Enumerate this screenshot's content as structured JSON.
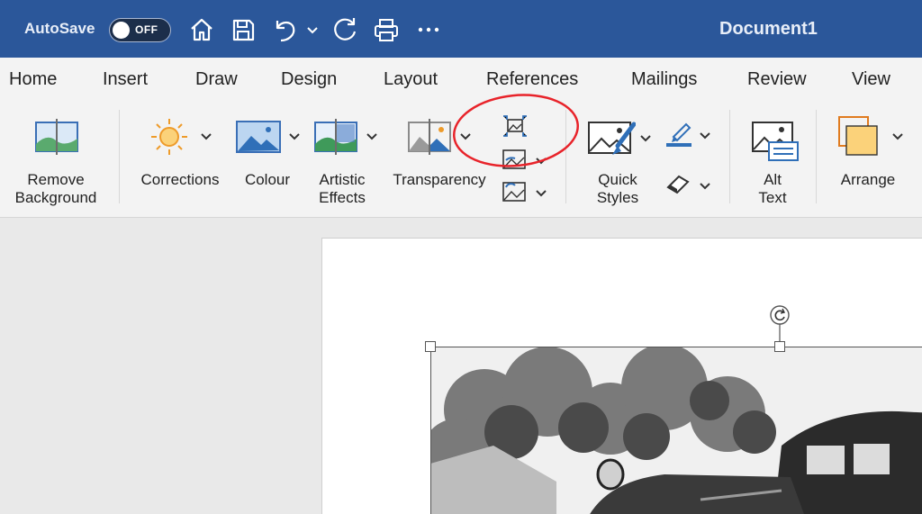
{
  "titlebar": {
    "autosave_label": "AutoSave",
    "toggle_text": "OFF",
    "document_title": "Document1",
    "background_color": "#2b579a"
  },
  "tabs": [
    "Home",
    "Insert",
    "Draw",
    "Design",
    "Layout",
    "References",
    "Mailings",
    "Review",
    "View"
  ],
  "ribbon": {
    "remove_background": [
      "Remove",
      "Background"
    ],
    "corrections": "Corrections",
    "colour": "Colour",
    "artistic_effects": [
      "Artistic",
      "Effects"
    ],
    "transparency": "Transparency",
    "quick_styles": [
      "Quick",
      "Styles"
    ],
    "alt_text": [
      "Alt",
      "Text"
    ],
    "arrange": "Arrange"
  },
  "icons": {
    "home": "home-icon",
    "save": "save-icon",
    "undo": "undo-icon",
    "redo": "redo-icon",
    "print": "print-icon",
    "more": "more-icon",
    "compress": "compress-pictures-icon",
    "change_picture": "change-picture-icon",
    "reset_picture": "reset-picture-icon"
  },
  "annotation_color": "#e8232a"
}
